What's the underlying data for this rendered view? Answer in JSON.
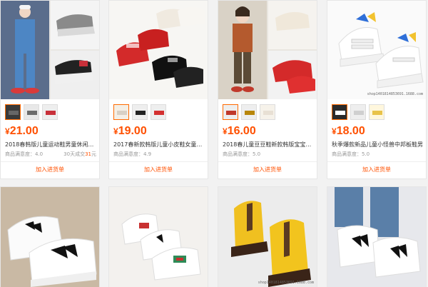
{
  "products": [
    {
      "price_symbol": "¥",
      "price": "21.00",
      "title": "2018春韩版儿童运动鞋男童休闲单鞋",
      "rating_label": "商品满意度：",
      "rating": "4.0",
      "return_note_prefix": "30天成交",
      "return_note_value": "31",
      "return_note_suffix": "元",
      "add_label": "加入进货单",
      "colors": [
        "#3a3a3a",
        "#6b6b6b",
        "#c8303a"
      ]
    },
    {
      "price_symbol": "¥",
      "price": "19.00",
      "title": "2017春新款韩版儿童小皮鞋女童鞋果",
      "rating_label": "商品满意度：",
      "rating": "4.9",
      "add_label": "加入进货单",
      "colors": [
        "#d8d0c4",
        "#222222",
        "#d33030"
      ]
    },
    {
      "price_symbol": "¥",
      "price": "16.00",
      "title": "2018春儿童豆豆鞋新款韩版宝宝甜美",
      "rating_label": "商品满意度：",
      "rating": "5.0",
      "add_label": "加入进货单",
      "colors": [
        "#c0392b",
        "#b8860b",
        "#e8e0d4"
      ]
    },
    {
      "price_symbol": "¥",
      "price": "18.00",
      "title": "秋季爆款新品儿童小怪兽中邦板鞋男",
      "rating_label": "商品满意度：",
      "rating": "5.0",
      "add_label": "加入进货单",
      "watermark": "shop1401814853691.1688.com",
      "colors": [
        "#2b2b2b",
        "#cfcfcf",
        "#e8c34a"
      ]
    }
  ],
  "row2_watermark": "shop1401814853691.1688.com"
}
